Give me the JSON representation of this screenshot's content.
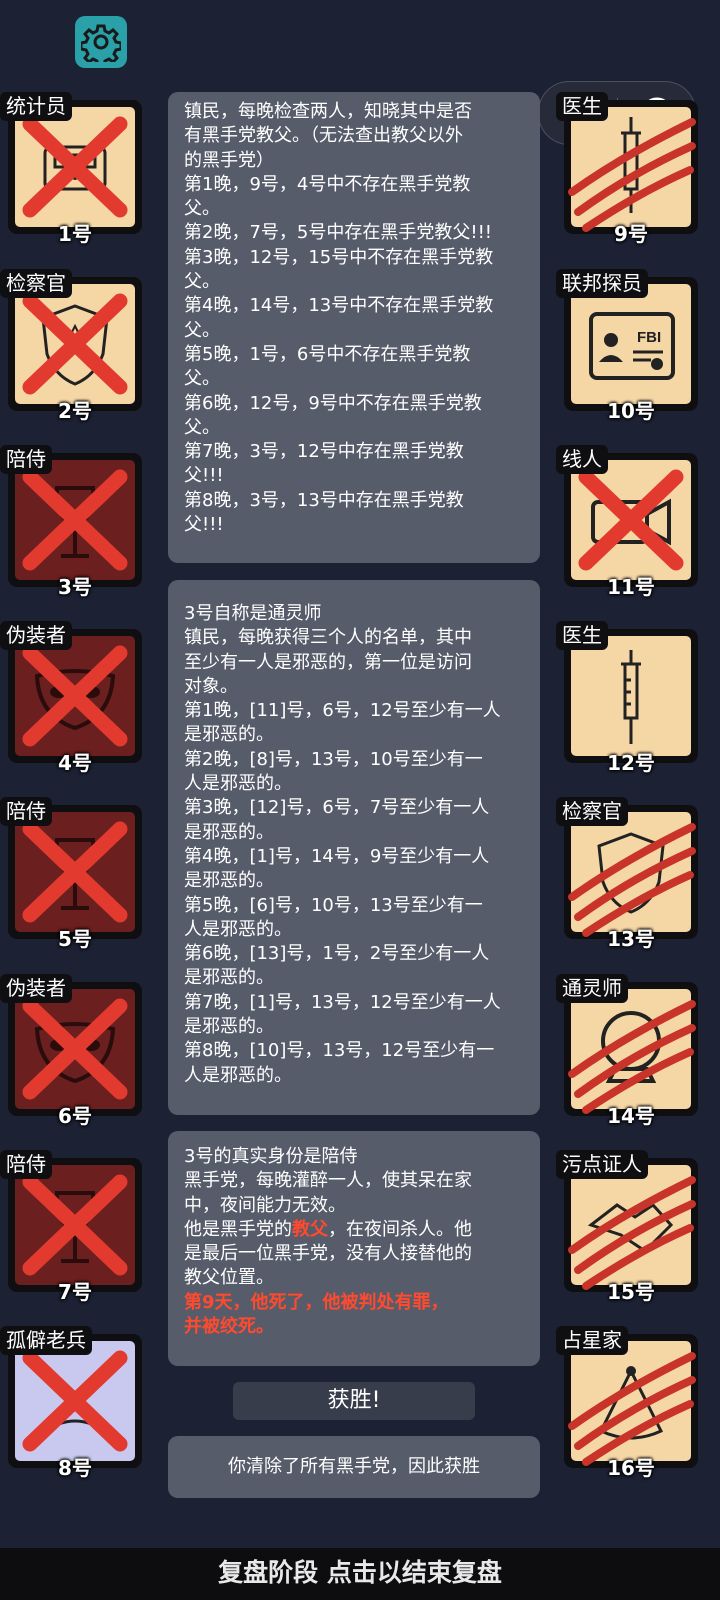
{
  "capsule": {
    "menu_glyph": "•●",
    "record_icon": "record-icon"
  },
  "left_cards": [
    {
      "role": "统计员",
      "num": "1号",
      "bg": "#f5d7a6",
      "crossed": true
    },
    {
      "role": "检察官",
      "num": "2号",
      "bg": "#f5d7a6",
      "crossed": true
    },
    {
      "role": "陪侍",
      "num": "3号",
      "bg": "#6b1f1f",
      "crossed": true
    },
    {
      "role": "伪装者",
      "num": "4号",
      "bg": "#6b1f1f",
      "crossed": true
    },
    {
      "role": "陪侍",
      "num": "5号",
      "bg": "#6b1f1f",
      "crossed": true
    },
    {
      "role": "伪装者",
      "num": "6号",
      "bg": "#6b1f1f",
      "crossed": true
    },
    {
      "role": "陪侍",
      "num": "7号",
      "bg": "#6b1f1f",
      "crossed": true
    },
    {
      "role": "孤僻老兵",
      "num": "8号",
      "bg": "#c9c9ef",
      "crossed": true
    }
  ],
  "right_cards": [
    {
      "role": "医生",
      "num": "9号",
      "bg": "#f5d7a6",
      "clawed": true
    },
    {
      "role": "联邦探员",
      "num": "10号",
      "bg": "#f5d7a6",
      "clawed": false
    },
    {
      "role": "线人",
      "num": "11号",
      "bg": "#f5d7a6",
      "crossed": true
    },
    {
      "role": "医生",
      "num": "12号",
      "bg": "#f5d7a6",
      "clawed": false
    },
    {
      "role": "检察官",
      "num": "13号",
      "bg": "#f5d7a6",
      "clawed": true
    },
    {
      "role": "通灵师",
      "num": "14号",
      "bg": "#f5d7a6",
      "clawed": true
    },
    {
      "role": "污点证人",
      "num": "15号",
      "bg": "#f5d7a6",
      "clawed": true
    },
    {
      "role": "占星家",
      "num": "16号",
      "bg": "#f5d7a6",
      "clawed": true
    }
  ],
  "log1": {
    "lines": [
      "镇民，每晚检查两人，知晓其中是否",
      "有黑手党教父。（无法查出教父以外",
      "的黑手党）",
      "第1晚，9号，4号中不存在黑手党教",
      "父。",
      "第2晚，7号，5号中存在黑手党教父!!!",
      "第3晚，12号，15号中不存在黑手党教",
      "父。",
      "第4晚，14号，13号中不存在黑手党教",
      "父。",
      "第5晚，1号，6号中不存在黑手党教",
      "父。",
      "第6晚，12号，9号中不存在黑手党教",
      "父。",
      "第7晚，3号，12号中存在黑手党教",
      "父!!!",
      "第8晚，3号，13号中存在黑手党教",
      "父!!!"
    ]
  },
  "log2": {
    "lines": [
      "3号自称是通灵师",
      "镇民，每晚获得三个人的名单，其中",
      "至少有一人是邪恶的，第一位是访问",
      "对象。",
      "第1晚，[11]号，6号，12号至少有一人",
      "是邪恶的。",
      "第2晚，[8]号，13号，10号至少有一",
      "人是邪恶的。",
      "第3晚，[12]号，6号，7号至少有一人",
      "是邪恶的。",
      "第4晚，[1]号，14号，9号至少有一人",
      "是邪恶的。",
      "第5晚，[6]号，10号，13号至少有一",
      "人是邪恶的。",
      "第6晚，[13]号，1号，2号至少有一人",
      "是邪恶的。",
      "第7晚，[1]号，13号，12号至少有一人",
      "是邪恶的。",
      "第8晚，[10]号，13号，12号至少有一",
      "人是邪恶的。"
    ]
  },
  "log3": {
    "line1": "3号的真实身份是陪侍",
    "line2": "黑手党，每晚灌醉一人，使其呆在家",
    "line3": "中，夜间能力无效。",
    "line4_pre": "他是黑手党的",
    "line4_red": "教父",
    "line4_post": "，在夜间杀人。他",
    "line5": "是最后一位黑手党，没有人接替他的",
    "line6": "教父位置。",
    "red_line1": "第9天，他死了，他被判处有罪，",
    "red_line2": "并被绞死。"
  },
  "win_label": "获胜!",
  "win_message": "你清除了所有黑手党，因此获胜",
  "bottom_bar": "复盘阶段 点击以结束复盘",
  "colors": {
    "background": "#1c2233",
    "panel": "#575c6b",
    "accent_red": "#ff4a2e",
    "settings": "#2aa1a8"
  }
}
